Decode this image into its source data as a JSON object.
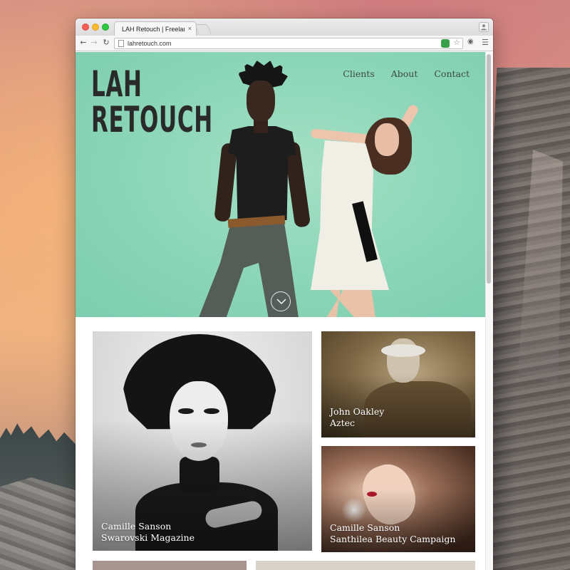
{
  "browser": {
    "tab_title": "LAH Retouch | Freelance R",
    "tab_close": "×",
    "url": "lahretouch.com",
    "nav_back": "←",
    "nav_forward": "→",
    "nav_reload": "↻",
    "menu_glyph": "☰"
  },
  "site": {
    "logo_line1": "LAH",
    "logo_line2": "RETOUCH",
    "nav": [
      "Clients",
      "About",
      "Contact"
    ],
    "accent_color": "#8ed7ba"
  },
  "portfolio": [
    {
      "name": "Camille Sanson",
      "project": "Swarovski Magazine"
    },
    {
      "name": "John Oakley",
      "project": "Aztec"
    },
    {
      "name": "Camille Sanson",
      "project": "Santhilea Beauty Campaign"
    }
  ]
}
